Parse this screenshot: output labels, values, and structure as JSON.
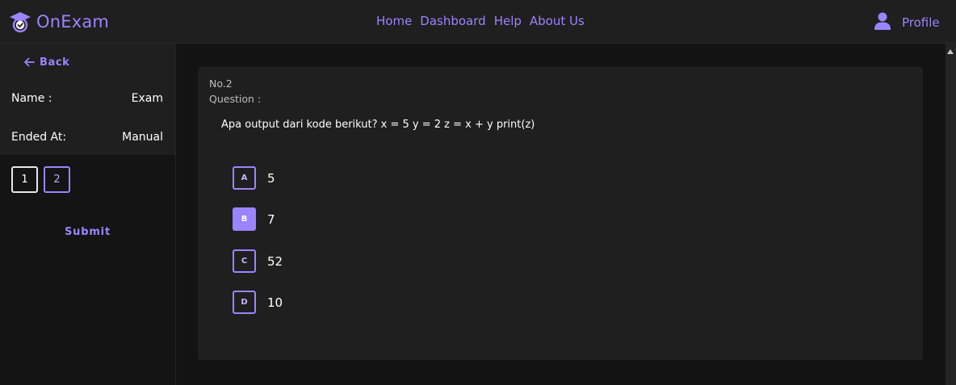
{
  "navbar": {
    "brand": "OnExam",
    "links": [
      "Home",
      "Dashboard",
      "Help",
      "About Us"
    ],
    "profile_label": "Profile"
  },
  "sidebar": {
    "back_label": "Back",
    "name_label": "Name :",
    "name_value": "Exam",
    "ended_label": "Ended At:",
    "ended_value": "Manual",
    "question_numbers": [
      "1",
      "2"
    ],
    "active_question": "2",
    "submit_label": "Submit"
  },
  "question": {
    "number": "No.2",
    "label": "Question :",
    "text": "Apa output dari kode berikut? x = 5 y = 2 z = x + y print(z)",
    "options": [
      {
        "key": "A",
        "text": "5"
      },
      {
        "key": "B",
        "text": "7"
      },
      {
        "key": "C",
        "text": "52"
      },
      {
        "key": "D",
        "text": "10"
      }
    ],
    "selected": "B"
  },
  "colors": {
    "accent": "#9b84ff",
    "page_bg": "#131313",
    "panel_bg": "#1f1f1f",
    "text": "#ffffff",
    "muted_text": "#bdbdbd"
  },
  "icons": {
    "brand": "graduation-cap-check-icon",
    "profile": "user-icon",
    "back": "arrow-left-icon"
  }
}
